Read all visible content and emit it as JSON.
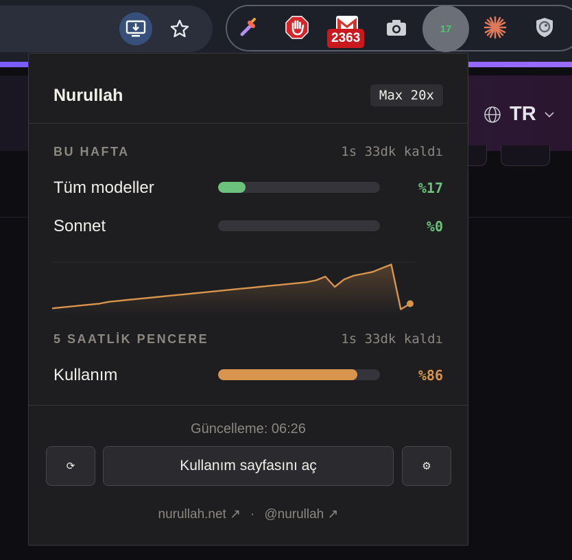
{
  "browser": {
    "extension_badge_count": "2363",
    "active_extension_label": "17",
    "colors": {
      "toolbar": "#1d2028",
      "accent_bar": "#8c63ff"
    }
  },
  "page": {
    "language_code": "TR"
  },
  "popup": {
    "user_name": "Nurullah",
    "plan": "Max 20x",
    "weekly": {
      "section_label": "BU HAFTA",
      "remaining": "1s 33dk kaldı",
      "meters": [
        {
          "label": "Tüm modeller",
          "percent_text": "%17",
          "value": 0.17,
          "color": "#6cc27a"
        },
        {
          "label": "Sonnet",
          "percent_text": "%0",
          "value": 0.0,
          "color": "#6cc27a"
        }
      ]
    },
    "usage_history": [
      0.04,
      0.06,
      0.08,
      0.1,
      0.12,
      0.14,
      0.18,
      0.2,
      0.22,
      0.24,
      0.26,
      0.28,
      0.3,
      0.32,
      0.34,
      0.36,
      0.38,
      0.4,
      0.42,
      0.44,
      0.46,
      0.48,
      0.5,
      0.52,
      0.54,
      0.56,
      0.58,
      0.6,
      0.64,
      0.72,
      0.5,
      0.66,
      0.74,
      0.78,
      0.82,
      0.9,
      0.98,
      0.02,
      0.14
    ],
    "window": {
      "section_label": "5 SAATLİK PENCERE",
      "remaining": "1s 33dk kaldı",
      "meter": {
        "label": "Kullanım",
        "percent_text": "%86",
        "value": 0.86,
        "color": "#d9954e"
      }
    },
    "updated_text": "Güncelleme: 06:26",
    "buttons": {
      "refresh_glyph": "⟳",
      "open_label": "Kullanım sayfasını aç",
      "settings_glyph": "⚙"
    },
    "links": {
      "site": "nurullah.net ↗",
      "separator": "·",
      "handle": "@nurullah ↗"
    }
  }
}
